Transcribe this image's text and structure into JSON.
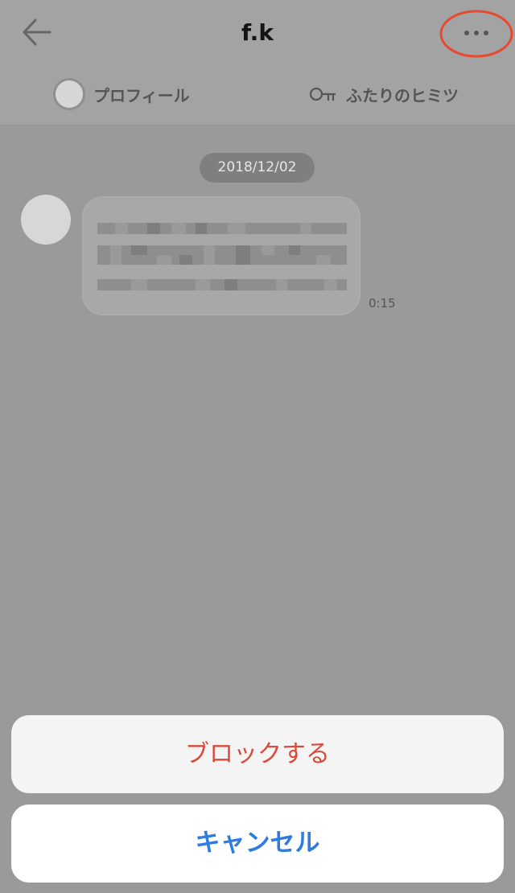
{
  "header": {
    "title": "f.k",
    "tabs": {
      "profile": "プロフィール",
      "secret": "ふたりのヒミツ"
    }
  },
  "chat": {
    "date_divider": "2018/12/02",
    "messages": [
      {
        "time": "0:15"
      }
    ]
  },
  "action_sheet": {
    "block_label": "ブロックする",
    "cancel_label": "キャンセル"
  },
  "colors": {
    "highlight_circle": "#e8482e",
    "destructive": "#d94a3a",
    "cancel": "#2f7be1"
  }
}
